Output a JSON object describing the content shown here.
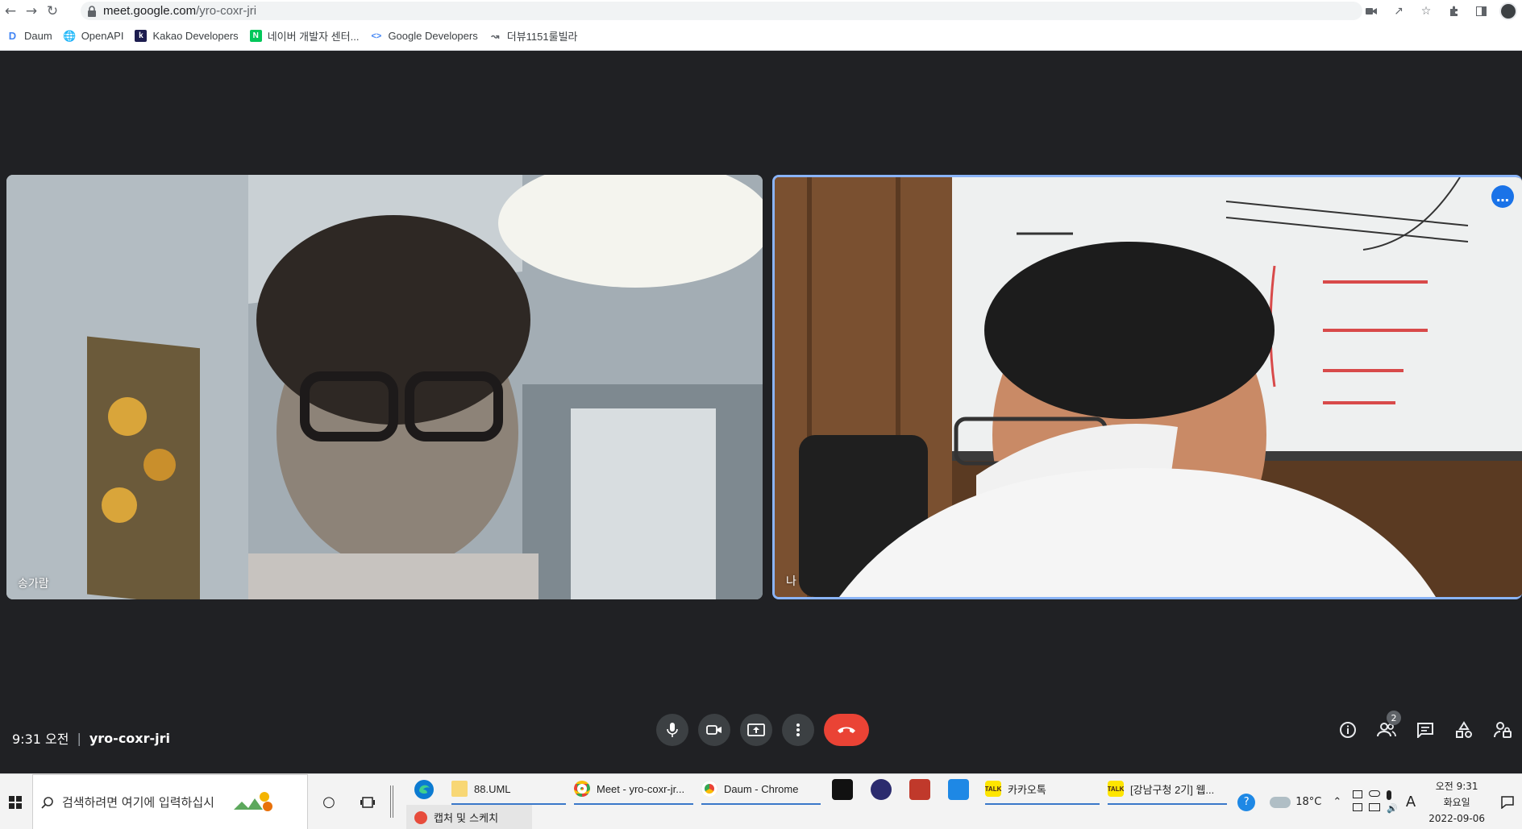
{
  "browser": {
    "url_host": "meet.google.com",
    "url_path": "/yro-coxr-jri",
    "bookmarks": [
      {
        "label": "Daum",
        "icon": "daum-icon",
        "color": "#4285f4"
      },
      {
        "label": "OpenAPI",
        "icon": "globe-icon",
        "color": "#5f6368"
      },
      {
        "label": "Kakao Developers",
        "icon": "kakao-k-icon",
        "color": "#1d1d4f"
      },
      {
        "label": "네이버 개발자 센터...",
        "icon": "naver-icon",
        "color": "#03c75a"
      },
      {
        "label": "Google Developers",
        "icon": "google-dev-icon",
        "color": "#4285f4"
      },
      {
        "label": "더뷰1151룰빌라",
        "icon": "chart-icon",
        "color": "#5f6368"
      }
    ]
  },
  "meet": {
    "participants": [
      {
        "name": "송가람"
      },
      {
        "name": "나"
      }
    ],
    "time": "9:31 오전",
    "meeting_code": "yro-coxr-jri",
    "participant_count": "2",
    "accent": "#8ab4f8",
    "end_call_color": "#ea4335"
  },
  "taskbar": {
    "search_placeholder": "검색하려면 여기에 입력하십시",
    "tasks": [
      {
        "label": "88.UML",
        "icon": "folder-icon"
      },
      {
        "label": "Meet - yro-coxr-jr...",
        "icon": "chrome-icon"
      },
      {
        "label": "Daum - Chrome",
        "icon": "chrome-icon"
      },
      {
        "label": "카카오톡",
        "icon": "kakaotalk-icon"
      },
      {
        "label": "[강남구청 2기] 웹...",
        "icon": "kakaotalk-icon"
      }
    ],
    "subtask": "캡처 및 스케치",
    "weather": "18°C",
    "ime": "A",
    "clock_time": "오전 9:31",
    "clock_day": "화요일",
    "clock_date": "2022-09-06"
  }
}
